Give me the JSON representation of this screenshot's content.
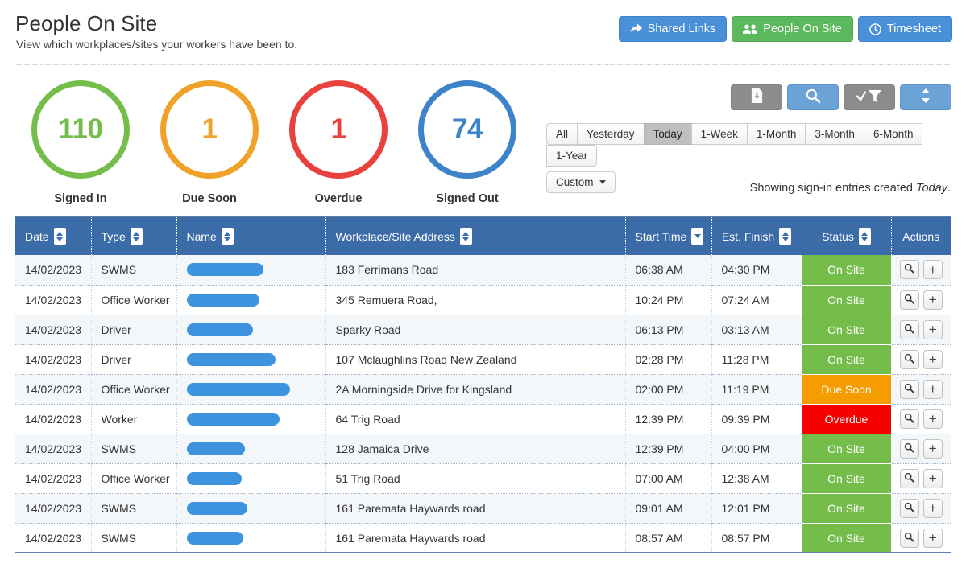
{
  "header": {
    "title": "People On Site",
    "subtitle": "View which workplaces/sites your workers have been to.",
    "buttons": [
      {
        "label": "Shared Links",
        "style": "blue",
        "icon": "share-icon"
      },
      {
        "label": "People On Site",
        "style": "green",
        "icon": "people-icon"
      },
      {
        "label": "Timesheet",
        "style": "blue",
        "icon": "clock-icon"
      }
    ]
  },
  "stats": [
    {
      "value": "110",
      "label": "Signed In",
      "color": "#74bd4a"
    },
    {
      "value": "1",
      "label": "Due Soon",
      "color": "#f0a12a"
    },
    {
      "value": "1",
      "label": "Overdue",
      "color": "#e8413e"
    },
    {
      "value": "74",
      "label": "Signed Out",
      "color": "#3d83c9"
    }
  ],
  "toolbar": {
    "icon_buttons": [
      {
        "name": "export-button",
        "icon": "file-download-icon",
        "style": "grey"
      },
      {
        "name": "search-button",
        "icon": "search-icon",
        "style": "blue"
      },
      {
        "name": "filter-button",
        "icon": "check-funnel-icon",
        "style": "grey"
      },
      {
        "name": "sort-button",
        "icon": "sort-updown-icon",
        "style": "blue"
      }
    ],
    "ranges": [
      "All",
      "Yesterday",
      "Today",
      "1-Week",
      "1-Month",
      "3-Month",
      "6-Month",
      "1-Year"
    ],
    "active_range": "Today",
    "custom_label": "Custom",
    "showing_prefix": "Showing sign-in entries created ",
    "showing_value": "Today",
    "showing_suffix": "."
  },
  "table": {
    "columns": [
      {
        "label": "Date",
        "sort": "both"
      },
      {
        "label": "Type",
        "sort": "both"
      },
      {
        "label": "Name",
        "sort": "both"
      },
      {
        "label": "Workplace/Site Address",
        "sort": "both"
      },
      {
        "label": "Start Time",
        "sort": "desc"
      },
      {
        "label": "Est. Finish",
        "sort": "both"
      },
      {
        "label": "Status",
        "sort": "both"
      },
      {
        "label": "Actions",
        "sort": "none"
      }
    ],
    "status_colors": {
      "On Site": "#74bd4a",
      "Due Soon": "#f59c00",
      "Overdue": "#f60000"
    },
    "action_icons": [
      "magnifier-icon",
      "plus-icon"
    ],
    "rows": [
      {
        "date": "14/02/2023",
        "type": "SWMS",
        "name_width": 95,
        "address": "183 Ferrimans Road",
        "start": "06:38 AM",
        "finish": "04:30 PM",
        "status": "On Site"
      },
      {
        "date": "14/02/2023",
        "type": "Office Worker",
        "name_width": 90,
        "address": "345 Remuera Road,",
        "start": "10:24 PM",
        "finish": "07:24 AM",
        "status": "On Site"
      },
      {
        "date": "14/02/2023",
        "type": "Driver",
        "name_width": 82,
        "address": "Sparky Road",
        "start": "06:13 PM",
        "finish": "03:13 AM",
        "status": "On Site"
      },
      {
        "date": "14/02/2023",
        "type": "Driver",
        "name_width": 110,
        "address": "107 Mclaughlins Road New Zealand",
        "start": "02:28 PM",
        "finish": "11:28 PM",
        "status": "On Site"
      },
      {
        "date": "14/02/2023",
        "type": "Office Worker",
        "name_width": 128,
        "address": "2A Morningside Drive for Kingsland",
        "start": "02:00 PM",
        "finish": "11:19 PM",
        "status": "Due Soon"
      },
      {
        "date": "14/02/2023",
        "type": "Worker",
        "name_width": 115,
        "address": "64 Trig Road",
        "start": "12:39 PM",
        "finish": "09:39 PM",
        "status": "Overdue"
      },
      {
        "date": "14/02/2023",
        "type": "SWMS",
        "name_width": 72,
        "address": "128 Jamaica Drive",
        "start": "12:39 PM",
        "finish": "04:00 PM",
        "status": "On Site"
      },
      {
        "date": "14/02/2023",
        "type": "Office Worker",
        "name_width": 68,
        "address": "51 Trig Road",
        "start": "07:00 AM",
        "finish": "12:38 AM",
        "status": "On Site"
      },
      {
        "date": "14/02/2023",
        "type": "SWMS",
        "name_width": 75,
        "address": "161 Paremata Haywards road",
        "start": "09:01 AM",
        "finish": "12:01 PM",
        "status": "On Site"
      },
      {
        "date": "14/02/2023",
        "type": "SWMS",
        "name_width": 70,
        "address": "161 Paremata Haywards road",
        "start": "08:57 AM",
        "finish": "08:57 PM",
        "status": "On Site"
      }
    ]
  }
}
